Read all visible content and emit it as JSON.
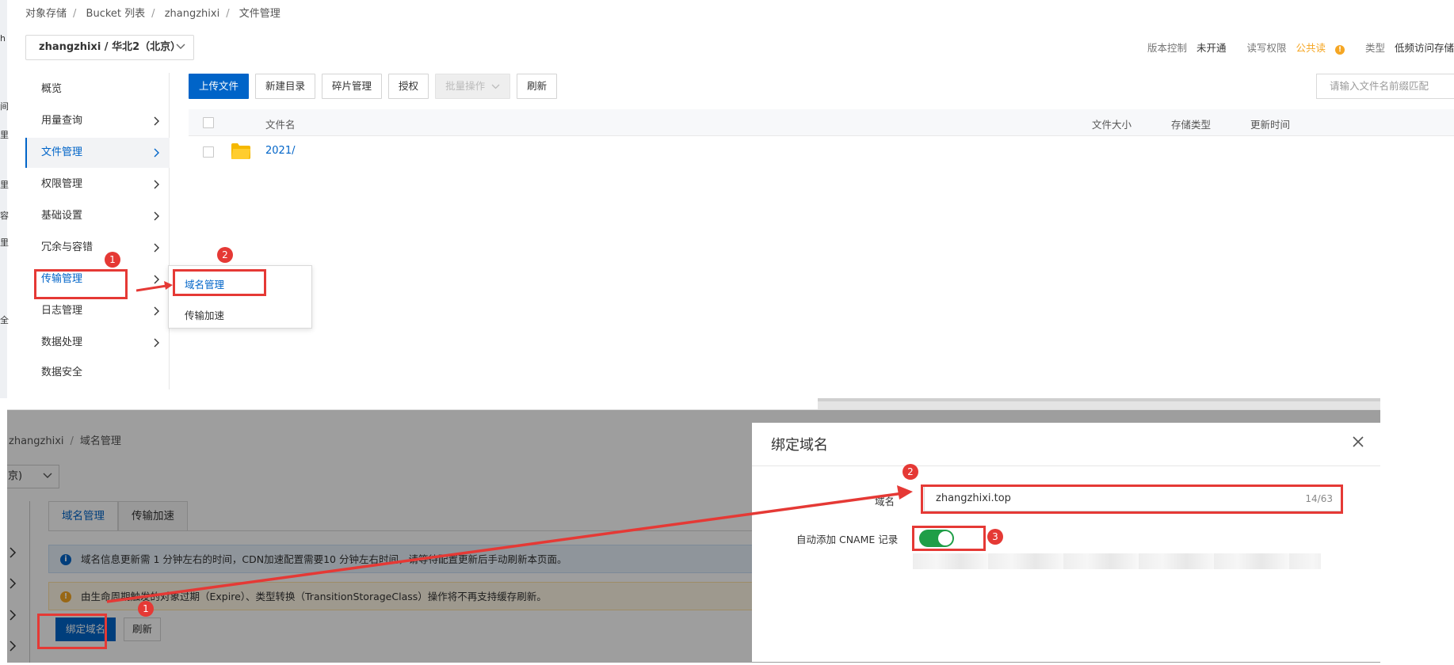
{
  "top": {
    "breadcrumb": [
      "对象存储",
      "Bucket 列表",
      "zhangzhixi",
      "文件管理"
    ],
    "region_select": "zhangzhixi / 华北2（北京）",
    "info": {
      "version_label": "版本控制",
      "version_value": "未开通",
      "acl_label": "读写权限",
      "acl_value": "公共读",
      "type_label": "类型",
      "type_value": "低频访问存储"
    },
    "left_strip_chars": [
      "h",
      "间",
      "里",
      "里",
      "容",
      "里",
      "全"
    ],
    "sidebar": [
      {
        "label": "概览"
      },
      {
        "label": "用量查询"
      },
      {
        "label": "文件管理"
      },
      {
        "label": "权限管理"
      },
      {
        "label": "基础设置"
      },
      {
        "label": "冗余与容错"
      },
      {
        "label": "传输管理"
      },
      {
        "label": "日志管理"
      },
      {
        "label": "数据处理"
      },
      {
        "label": "数据安全"
      }
    ],
    "toolbar": {
      "upload": "上传文件",
      "new_dir": "新建目录",
      "fragments": "碎片管理",
      "authorize": "授权",
      "batch": "批量操作",
      "refresh": "刷新"
    },
    "search_placeholder": "请输入文件名前缀匹配",
    "table": {
      "headers": {
        "name": "文件名",
        "size": "文件大小",
        "storage": "存储类型",
        "updated": "更新时间"
      },
      "rows": [
        {
          "name": "2021/"
        }
      ]
    },
    "submenu": [
      "域名管理",
      "传输加速"
    ],
    "badges": [
      "1",
      "2"
    ]
  },
  "bottom": {
    "breadcrumb": [
      "zhangzhixi",
      "域名管理"
    ],
    "region_partial": "京)",
    "tabs": [
      "域名管理",
      "传输加速"
    ],
    "notice_info": "域名信息更新需 1 分钟左右的时间，CDN加速配置需要10 分钟左右时间，请等待配置更新后手动刷新本页面。",
    "notice_warn": "由生命周期触发的对象过期（Expire）、类型转换（TransitionStorageClass）操作将不再支持缓存刷新。",
    "bind_button": "绑定域名",
    "refresh_button": "刷新",
    "badge": "1"
  },
  "dialog": {
    "title": "绑定域名",
    "domain_label": "域名",
    "domain_value": "zhangzhixi.top",
    "domain_count": "14/63",
    "cname_label": "自动添加 CNAME 记录",
    "cname_enabled": true,
    "badges": [
      "2",
      "3"
    ]
  },
  "colors": {
    "accent": "#0064c8",
    "annotation": "#e53935",
    "toggle_on": "#1f9e47",
    "warning": "#f5a623"
  }
}
